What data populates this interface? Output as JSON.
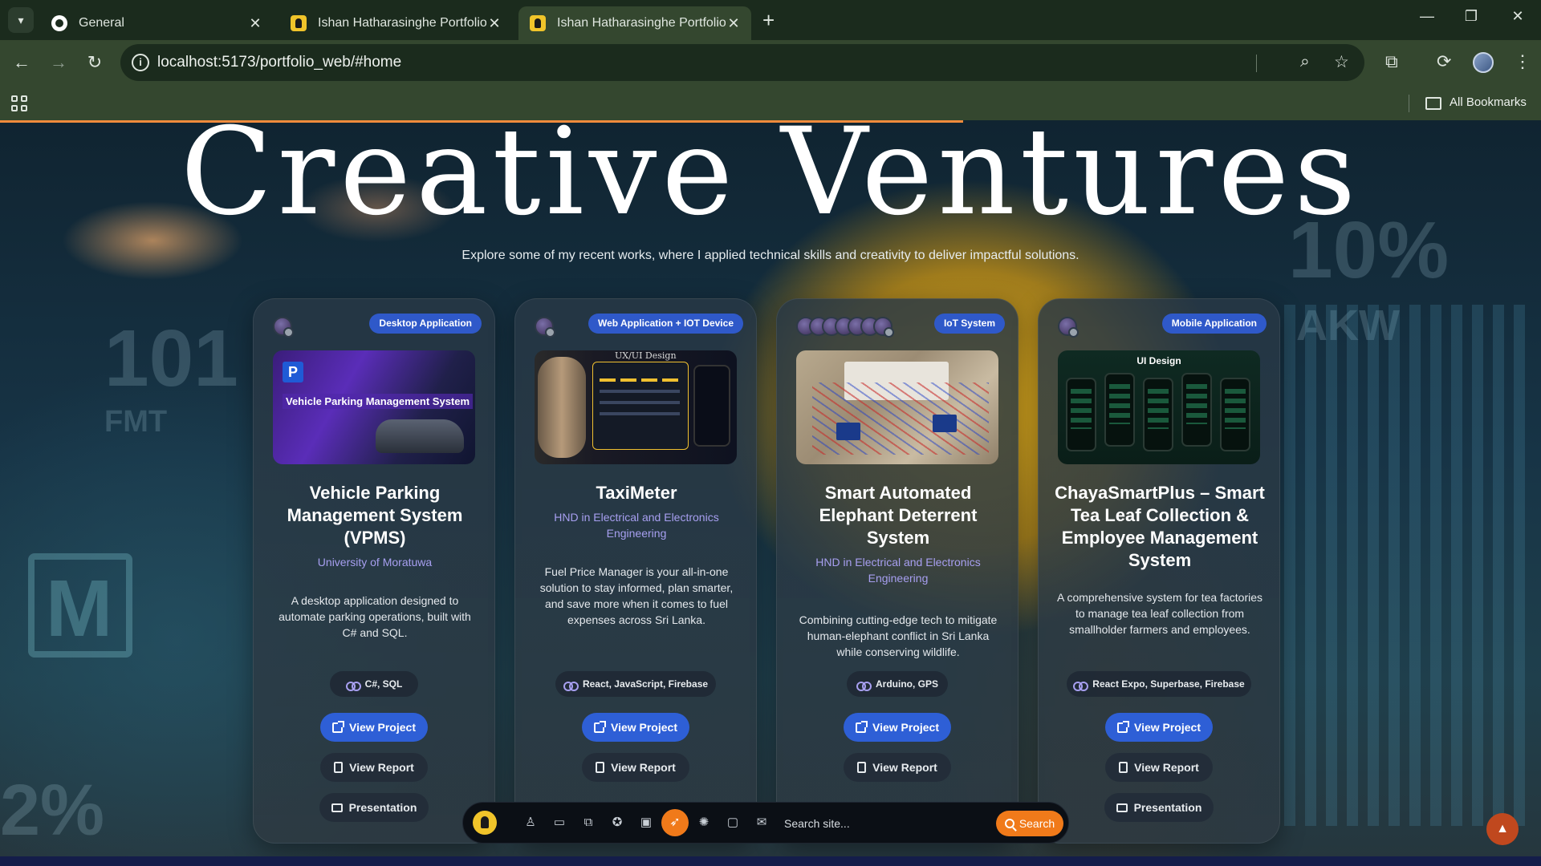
{
  "browser": {
    "tabs": [
      {
        "title": "General",
        "favicon": "github-icon",
        "active": false
      },
      {
        "title": "Ishan Hatharasinghe Portfolio",
        "favicon": "avatar-icon",
        "active": false
      },
      {
        "title": "Ishan Hatharasinghe Portfolio",
        "favicon": "avatar-icon",
        "active": true
      }
    ],
    "url": "localhost:5173/portfolio_web/#home",
    "bookmarks_label": "All Bookmarks"
  },
  "hero": {
    "title": "Creative Ventures",
    "subtitle": "Explore some of my recent works, where I applied technical skills and creativity to deliver impactful solutions."
  },
  "projects": [
    {
      "badge": "Desktop Application",
      "title": "Vehicle Parking Management System (VPMS)",
      "organization": "University of Moratuwa",
      "description": "A desktop application designed to automate parking operations, built with C# and SQL.",
      "tech": "C#, SQL",
      "thumb_text": "Vehicle Parking Management System",
      "view_project": "View Project",
      "view_report": "View Report",
      "presentation": "Presentation"
    },
    {
      "badge": "Web Application + IOT Device",
      "title": "TaxiMeter",
      "organization": "HND in Electrical and Electronics Engineering",
      "description": "Fuel Price Manager is your all-in-one solution to stay informed, plan smarter, and save more when it comes to fuel expenses across Sri Lanka.",
      "tech": "React, JavaScript, Firebase",
      "thumb_text": "UX/UI Design",
      "view_project": "View Project",
      "view_report": "View Report"
    },
    {
      "badge": "IoT System",
      "title": "Smart Automated Elephant Deterrent System",
      "organization": "HND in Electrical and Electronics Engineering",
      "description": "Combining cutting-edge tech to mitigate human-elephant conflict in Sri Lanka while conserving wildlife.",
      "tech": "Arduino, GPS",
      "view_project": "View Project",
      "view_report": "View Report"
    },
    {
      "badge": "Mobile Application",
      "title": "ChayaSmartPlus – Smart Tea Leaf Collection & Employee Management System",
      "organization": "",
      "description": "A comprehensive system for tea factories to manage tea leaf collection from smallholder farmers and employees.",
      "tech": "React Expo, Superbase, Firebase",
      "thumb_text": "UI Design",
      "view_project": "View Project",
      "view_report": "View Report",
      "presentation": "Presentation"
    }
  ],
  "dock": {
    "search_placeholder": "Search site...",
    "search_button": "Search",
    "icons": [
      "user-icon",
      "tablet-icon",
      "devices-icon",
      "award-icon",
      "briefcase-icon",
      "rocket-icon",
      "palette-icon",
      "chat-icon",
      "mail-icon"
    ],
    "active_icon": "rocket-icon"
  },
  "colors": {
    "accent_blue": "#2e5fd6",
    "accent_orange": "#f07a1a",
    "org_purple": "#a79ff0",
    "badge_blue": "#2f59c9"
  }
}
